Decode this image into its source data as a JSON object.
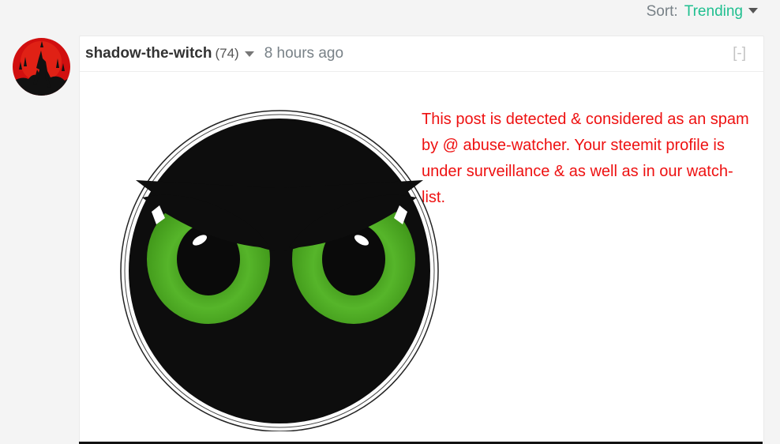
{
  "sort": {
    "label": "Sort:",
    "value": "Trending"
  },
  "comment": {
    "author": "shadow-the-witch",
    "reputation": "(74)",
    "timestamp": "8 hours ago",
    "collapse_label": "[-]",
    "body_text": "This post is detected & considered as an spam by @ abuse-watcher. Your steemit profile is under surveillance & as well as in our watch-list.",
    "avatar_icon": "witch-silhouette-avatar",
    "image_icon": "angry-green-eyes-image"
  },
  "colors": {
    "accent": "#1fbf8f",
    "warning_text": "#ee1111",
    "eye_green": "#5cb82a"
  }
}
